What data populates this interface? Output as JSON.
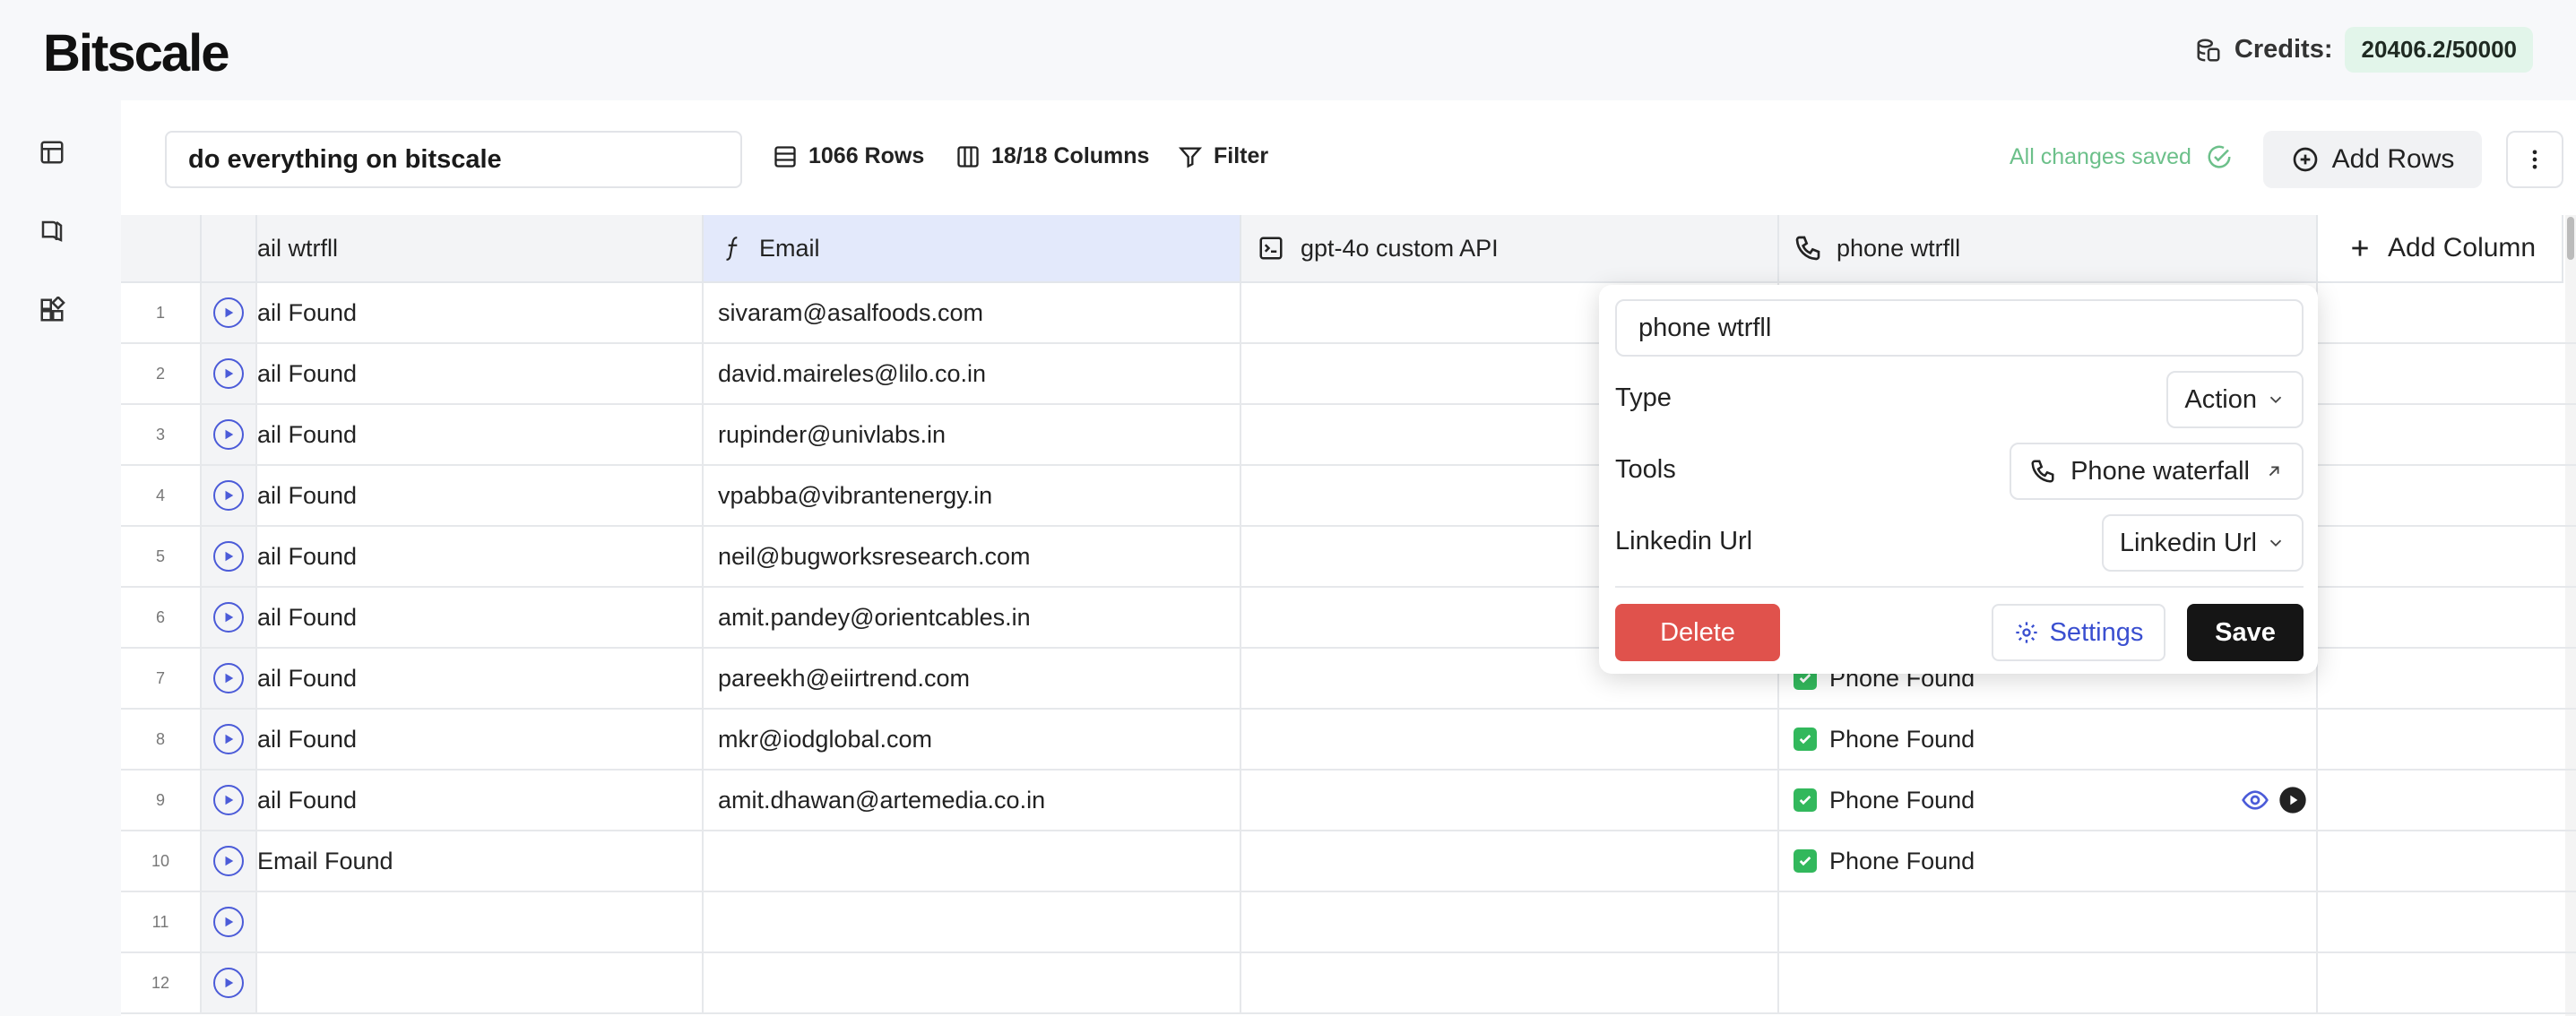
{
  "brand": {
    "logo": "Bitscale"
  },
  "credits": {
    "label": "Credits:",
    "value": "20406.2/50000"
  },
  "toolbar": {
    "sheet_name": "do everything on bitscale",
    "rows": "1066 Rows",
    "columns": "18/18 Columns",
    "filter": "Filter",
    "saved": "All changes saved",
    "add_rows": "Add Rows"
  },
  "columns": {
    "c1": "ail wtrfll",
    "c2": "Email",
    "c3": "gpt-4o custom API",
    "c4": "phone wtrfll",
    "add": "Add Column"
  },
  "rows": [
    {
      "n": "1",
      "a": "ail Found",
      "b": "sivaram@asalfoods.com",
      "d": ""
    },
    {
      "n": "2",
      "a": "ail Found",
      "b": "david.maireles@lilo.co.in",
      "d": ""
    },
    {
      "n": "3",
      "a": "ail Found",
      "b": "rupinder@univlabs.in",
      "d": ""
    },
    {
      "n": "4",
      "a": "ail Found",
      "b": "vpabba@vibrantenergy.in",
      "d": ""
    },
    {
      "n": "5",
      "a": "ail Found",
      "b": "neil@bugworksresearch.com",
      "d": ""
    },
    {
      "n": "6",
      "a": "ail Found",
      "b": "amit.pandey@orientcables.in",
      "d": ""
    },
    {
      "n": "7",
      "a": "ail Found",
      "b": "pareekh@eiirtrend.com",
      "d": "Phone Found"
    },
    {
      "n": "8",
      "a": "ail Found",
      "b": "mkr@iodglobal.com",
      "d": "Phone Found"
    },
    {
      "n": "9",
      "a": "ail Found",
      "b": "amit.dhawan@artemedia.co.in",
      "d": "Phone Found"
    },
    {
      "n": "10",
      "a": "Email Found",
      "b": "",
      "d": "Phone Found"
    },
    {
      "n": "11",
      "a": "",
      "b": "",
      "d": ""
    },
    {
      "n": "12",
      "a": "",
      "b": "",
      "d": ""
    }
  ],
  "popover": {
    "name": "phone wtrfll",
    "type_label": "Type",
    "type_value": "Action",
    "tools_label": "Tools",
    "tools_value": "Phone waterfall",
    "linkedin_label": "Linkedin Url",
    "linkedin_value": "Linkedin Url",
    "delete": "Delete",
    "settings": "Settings",
    "save": "Save"
  },
  "colors": {
    "accent": "#4b5bd8",
    "delete": "#e0524c",
    "save": "#151515",
    "success": "#32b85c",
    "saved": "#6cc08a"
  }
}
